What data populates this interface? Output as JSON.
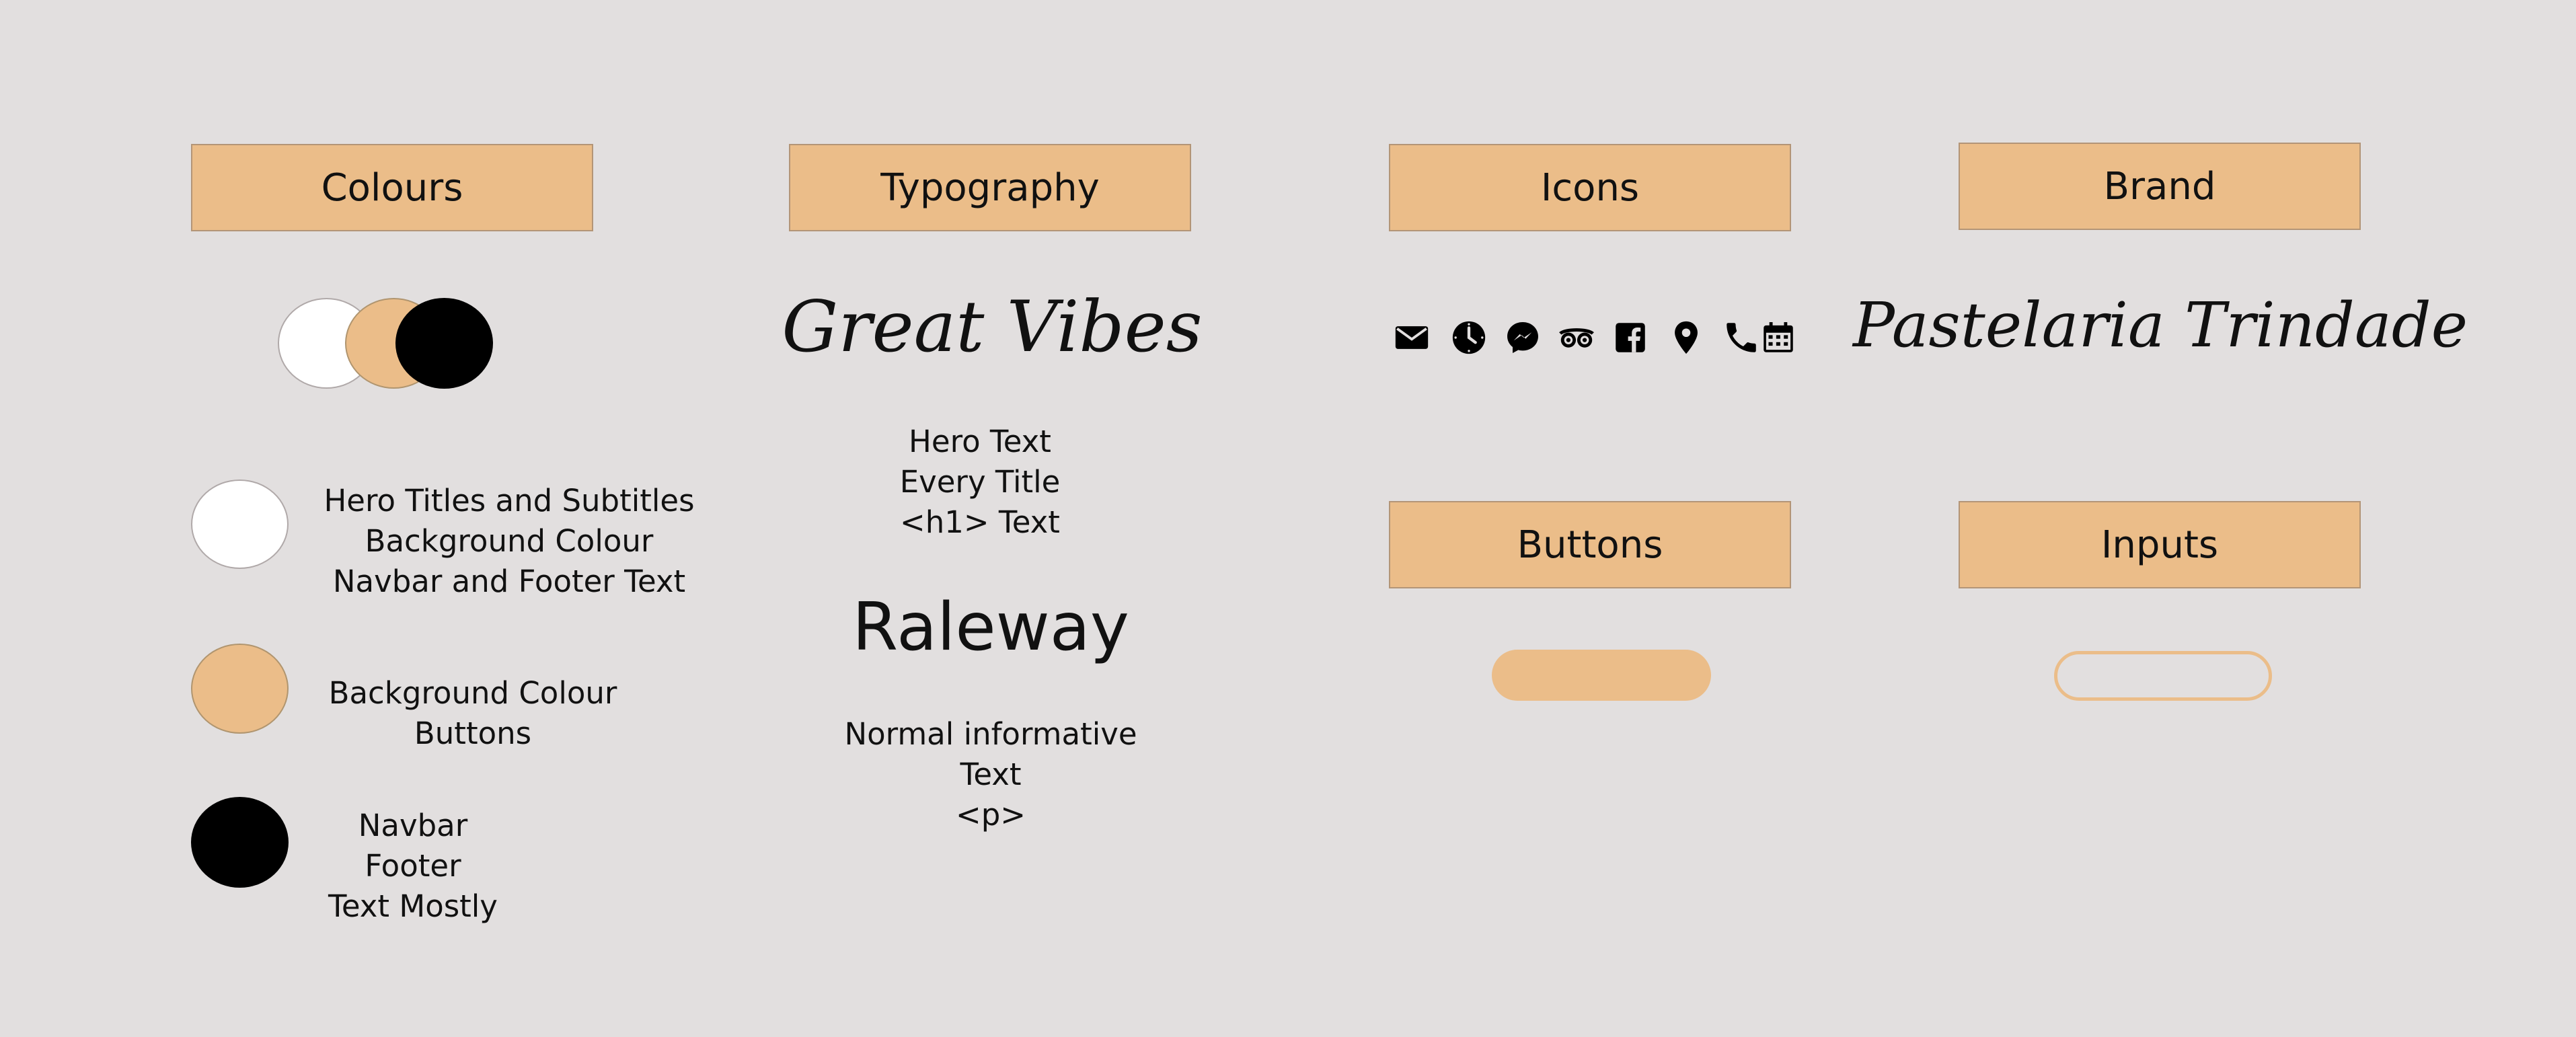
{
  "sections": {
    "colours": "Colours",
    "typography": "Typography",
    "icons": "Icons",
    "brand": "Brand",
    "buttons": "Buttons",
    "inputs": "Inputs"
  },
  "colors": {
    "white": "#ffffff",
    "accent": "#ebbd89",
    "black": "#000000",
    "background": "#e2dfdf"
  },
  "colour_usage": {
    "white": [
      "Hero Titles and Subtitles",
      "Background Colour",
      "Navbar and Footer Text"
    ],
    "accent": [
      "Background Colour",
      "Buttons"
    ],
    "black": [
      "Navbar",
      "Footer",
      "Text Mostly"
    ]
  },
  "typography": {
    "script_font_sample": "Great Vibes",
    "script_usage": [
      "Hero Text",
      "Every Title",
      "<h1> Text"
    ],
    "body_font_sample": "Raleway",
    "body_usage": [
      "Normal informative",
      "Text",
      "<p>"
    ]
  },
  "icons": [
    "mail-icon",
    "clock-icon",
    "messenger-icon",
    "tripadvisor-icon",
    "facebook-icon",
    "location-pin-icon",
    "phone-icon",
    "calendar-icon"
  ],
  "brand": {
    "name": "Pastelaria Trindade"
  }
}
